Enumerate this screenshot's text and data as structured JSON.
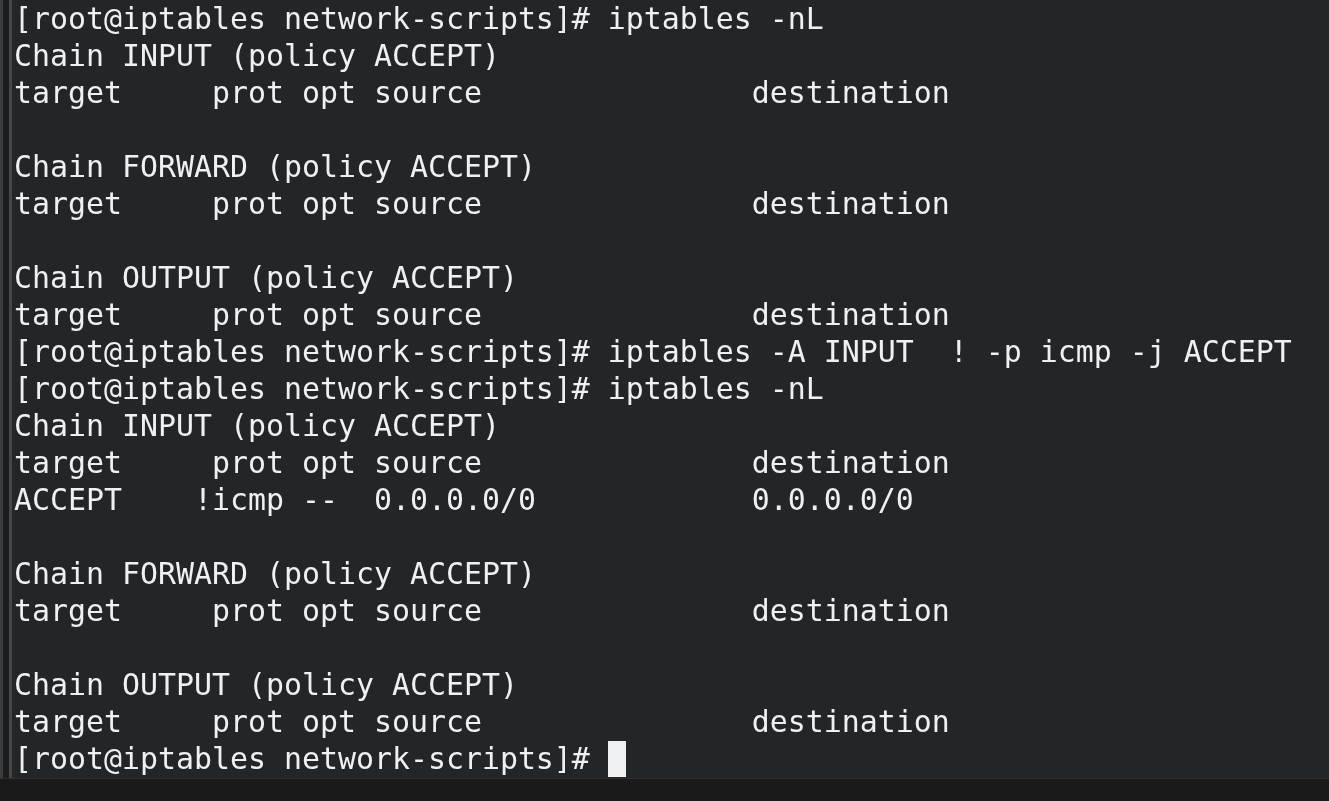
{
  "terminal": {
    "lines": [
      {
        "kind": "prompt",
        "prompt": "[root@iptables network-scripts]#",
        "command": "iptables -nL"
      },
      {
        "kind": "output",
        "text": "Chain INPUT (policy ACCEPT)"
      },
      {
        "kind": "output",
        "text": "target     prot opt source               destination"
      },
      {
        "kind": "blank"
      },
      {
        "kind": "output",
        "text": "Chain FORWARD (policy ACCEPT)"
      },
      {
        "kind": "output",
        "text": "target     prot opt source               destination"
      },
      {
        "kind": "blank"
      },
      {
        "kind": "output",
        "text": "Chain OUTPUT (policy ACCEPT)"
      },
      {
        "kind": "output",
        "text": "target     prot opt source               destination"
      },
      {
        "kind": "prompt",
        "prompt": "[root@iptables network-scripts]#",
        "command": "iptables -A INPUT  ! -p icmp -j ACCEPT"
      },
      {
        "kind": "prompt",
        "prompt": "[root@iptables network-scripts]#",
        "command": "iptables -nL"
      },
      {
        "kind": "output",
        "text": "Chain INPUT (policy ACCEPT)"
      },
      {
        "kind": "output",
        "text": "target     prot opt source               destination"
      },
      {
        "kind": "output",
        "text": "ACCEPT    !icmp --  0.0.0.0/0            0.0.0.0/0"
      },
      {
        "kind": "blank"
      },
      {
        "kind": "output",
        "text": "Chain FORWARD (policy ACCEPT)"
      },
      {
        "kind": "output",
        "text": "target     prot opt source               destination"
      },
      {
        "kind": "blank"
      },
      {
        "kind": "output",
        "text": "Chain OUTPUT (policy ACCEPT)"
      },
      {
        "kind": "output",
        "text": "target     prot opt source               destination"
      },
      {
        "kind": "prompt",
        "prompt": "[root@iptables network-scripts]#",
        "cursor": true
      }
    ]
  }
}
